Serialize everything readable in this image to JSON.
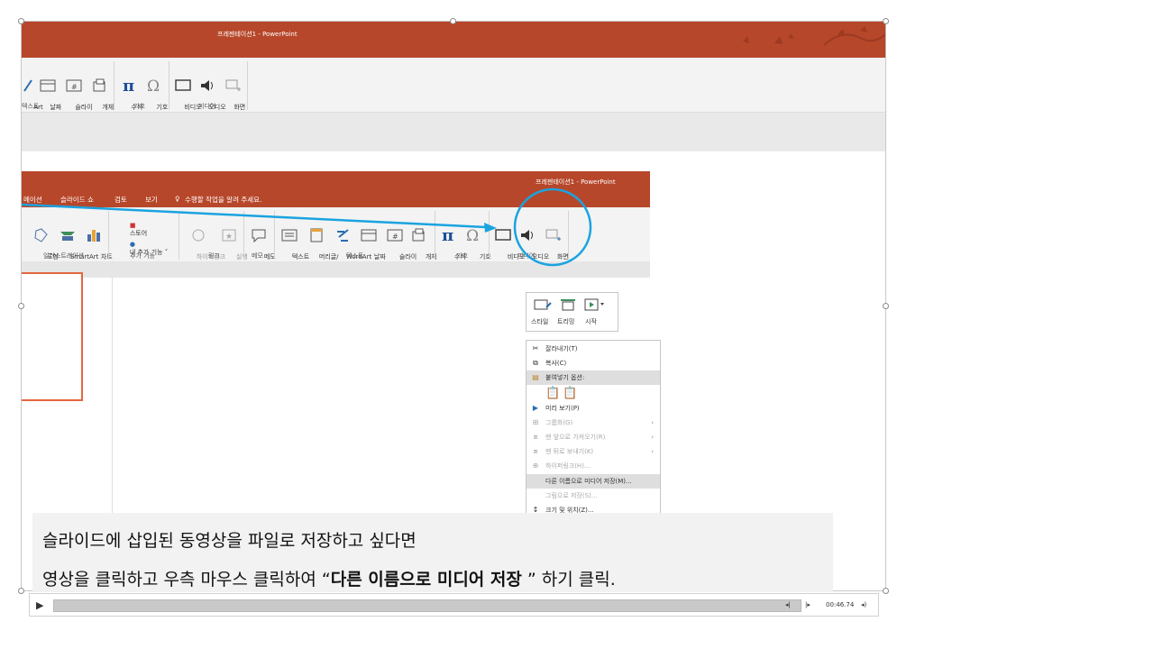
{
  "background_window": {
    "title": "프레젠테이션1 - PowerPoint",
    "ribbon_items": [
      {
        "label": "Art",
        "icon": "smartart-fragment-icon"
      },
      {
        "label": "날짜\n및 시간",
        "icon": "date-time-icon"
      },
      {
        "label": "슬라이\n드 번호",
        "icon": "slide-number-icon"
      },
      {
        "label": "개체",
        "icon": "object-icon"
      },
      {
        "label": "수식\n˅",
        "icon": "pi-equation-icon"
      },
      {
        "label": "기호",
        "icon": "omega-symbol-icon"
      },
      {
        "label": "비디오\n˅",
        "icon": "video-icon"
      },
      {
        "label": "오디오\n˅",
        "icon": "audio-icon"
      },
      {
        "label": "화면\n녹화",
        "icon": "screen-record-icon"
      }
    ],
    "groups": [
      "텍스트",
      "기호",
      "미디어"
    ]
  },
  "front_window": {
    "title": "프레젠테이션1 - PowerPoint",
    "tabs": [
      "메이션",
      "슬라이드 쇼",
      "검토",
      "보기"
    ],
    "tell_me": "수행할 작업을 알려 주세요.",
    "ribbon_items": [
      {
        "label": "도형\n˅",
        "icon": "shapes-icon"
      },
      {
        "label": "SmartArt",
        "icon": "smartart-icon"
      },
      {
        "label": "차트",
        "icon": "chart-icon"
      },
      {
        "label": "스토어",
        "icon": "store-icon"
      },
      {
        "label": "내 추가 기능 ˅",
        "icon": "my-addins-icon"
      },
      {
        "label": "하이퍼링크",
        "icon": "hyperlink-icon"
      },
      {
        "label": "실행",
        "icon": "action-icon"
      },
      {
        "label": "메모",
        "icon": "comment-icon"
      },
      {
        "label": "텍스트\n상자 ˅",
        "icon": "textbox-icon"
      },
      {
        "label": "머리글/\n바닥글",
        "icon": "header-footer-icon"
      },
      {
        "label": "WordArt\n˅",
        "icon": "wordart-icon"
      },
      {
        "label": "날짜\n및 시간",
        "icon": "date-time-icon"
      },
      {
        "label": "슬라이\n드 번호",
        "icon": "slide-number-icon"
      },
      {
        "label": "개체",
        "icon": "object-icon"
      },
      {
        "label": "수식\n˅",
        "icon": "pi-equation-icon"
      },
      {
        "label": "기호",
        "icon": "omega-symbol-icon"
      },
      {
        "label": "비디오\n˅",
        "icon": "video-icon"
      },
      {
        "label": "오디오\n˅",
        "icon": "audio-icon"
      },
      {
        "label": "화면\n녹화",
        "icon": "screen-record-icon"
      }
    ],
    "groups": [
      "일러스트레이션",
      "추가 기능",
      "링크",
      "메모",
      "텍스트",
      "기호",
      "미디어"
    ]
  },
  "mini_toolbar": {
    "items": [
      {
        "label": "스타일",
        "icon": "video-style-icon"
      },
      {
        "label": "트리밍",
        "icon": "trim-icon"
      },
      {
        "label": "시작",
        "icon": "start-icon"
      }
    ]
  },
  "context_menu": {
    "items": [
      {
        "label": "잘라내기(T)",
        "icon": "scissors-icon",
        "disabled": false,
        "submenu": false
      },
      {
        "label": "복사(C)",
        "icon": "copy-icon",
        "disabled": false,
        "submenu": false
      },
      {
        "label": "붙여넣기 옵션:",
        "icon": "paste-icon",
        "disabled": false,
        "submenu": false,
        "header": true
      },
      {
        "label": "",
        "icon": "paste-options-icon",
        "disabled": false,
        "submenu": false,
        "paste_row": true
      },
      {
        "label": "미리 보기(P)",
        "icon": "play-icon",
        "disabled": false,
        "submenu": false
      },
      {
        "label": "그룹화(G)",
        "icon": "group-icon",
        "disabled": true,
        "submenu": true
      },
      {
        "label": "맨 앞으로 가져오기(R)",
        "icon": "bring-front-icon",
        "disabled": true,
        "submenu": true
      },
      {
        "label": "맨 뒤로 보내기(K)",
        "icon": "send-back-icon",
        "disabled": true,
        "submenu": true
      },
      {
        "label": "하이퍼링크(H)...",
        "icon": "hyperlink-icon",
        "disabled": true,
        "submenu": false
      },
      {
        "label": "다른 이름으로 미디어 저장(M)...",
        "icon": "",
        "disabled": false,
        "submenu": false,
        "highlighted": true
      },
      {
        "label": "그림으로 저장(S)...",
        "icon": "",
        "disabled": true,
        "submenu": false
      },
      {
        "label": "크기 및 위치(Z)...",
        "icon": "size-position-icon",
        "disabled": false,
        "submenu": false
      }
    ]
  },
  "caption": {
    "line1": "슬라이드에 삽입된 동영상을 파일로 저장하고 싶다면",
    "line2_pre": "영상을 클릭하고 우측 마우스 클릭하여 “",
    "line2_bold": "다른 이름으로 미디어 저장",
    "line2_post": " ” 하기 클릭."
  },
  "player": {
    "time": "00:46.74"
  },
  "colors": {
    "ribbon_red": "#b7472a",
    "annotation_blue": "#1aa3e0",
    "thumb_border": "#e4673e"
  }
}
